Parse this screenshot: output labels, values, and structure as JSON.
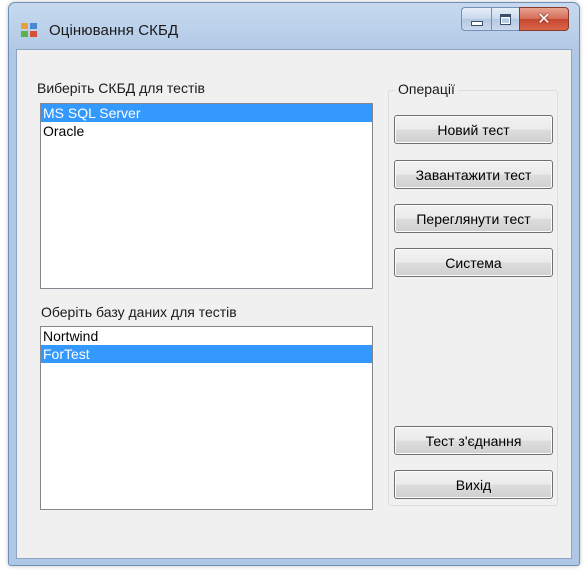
{
  "window": {
    "title": "Оцінювання СКБД",
    "controls": {
      "minimize": "–",
      "maximize": "□",
      "close": "✕"
    }
  },
  "dbms": {
    "label": "Виберіть СКБД для тестів",
    "items": [
      {
        "text": "MS SQL Server",
        "selected": true
      },
      {
        "text": "Oracle",
        "selected": false
      }
    ]
  },
  "database": {
    "label": "Оберіть базу даних для тестів",
    "items": [
      {
        "text": "Nortwind",
        "selected": false
      },
      {
        "text": "ForTest",
        "selected": true
      }
    ]
  },
  "operations": {
    "legend": "Операції",
    "new_test": "Новий тест",
    "load_test": "Завантажити тест",
    "view_test": "Переглянути тест",
    "system": "Система",
    "test_connection": "Тест з'єднання",
    "exit": "Вихід"
  },
  "colors": {
    "selection": "#3399ff",
    "client_bg": "#f0f0f0",
    "titlebar": "#b9cfe9",
    "close_button": "#c74630"
  }
}
